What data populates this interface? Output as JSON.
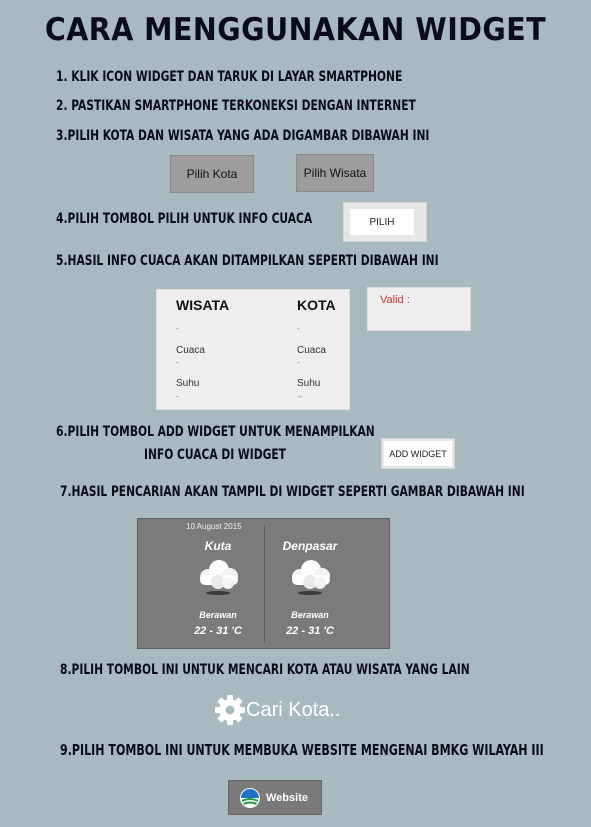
{
  "title": "Cara Menggunakan Widget",
  "steps": [
    "1. Klik icon widget dan taruk di layar smartphone",
    "2. Pastikan smartphone terkoneksi dengan internet",
    "3.Pilih kota dan wisata yang ada digambar dibawah ini",
    "4.Pilih tombol pilih untuk info cuaca",
    "5.Hasil info cuaca akan ditampilkan seperti dibawah ini",
    "6.Pilih tombol add widget untuk menampilkan",
    "info cuaca di widget",
    "7.Hasil pencarian akan tampil di widget seperti gambar  dibawah ini",
    "8.Pilih tombol ini untuk mencari kota atau wisata yang lain",
    "9.Pilih tombol ini untuk membuka website mengenai BMKG wilayah III"
  ],
  "buttons": {
    "pilih_kota": "Pilih Kota",
    "pilih_wisata": "Pilih Wisata",
    "pilih": "PILIH",
    "add_widget": "ADD WIDGET",
    "cari_kota": "Cari Kota..",
    "website": "Website"
  },
  "info_card": {
    "wisata_header": "WISATA",
    "kota_header": "KOTA",
    "dash": "-",
    "cuaca_label": "Cuaca",
    "suhu_label": "Suhu",
    "kota_suhu_value": "--",
    "valid_label": "Valid :"
  },
  "widget": {
    "date": "10 August 2015",
    "left": {
      "city": "Kuta",
      "condition": "Berawan",
      "temp": "22 - 31 'C"
    },
    "right": {
      "city": "Denpasar",
      "condition": "Berawan",
      "temp": "22 - 31 'C"
    }
  },
  "colors": {
    "background": "#a9b9c0",
    "valid_text": "#d03030"
  }
}
